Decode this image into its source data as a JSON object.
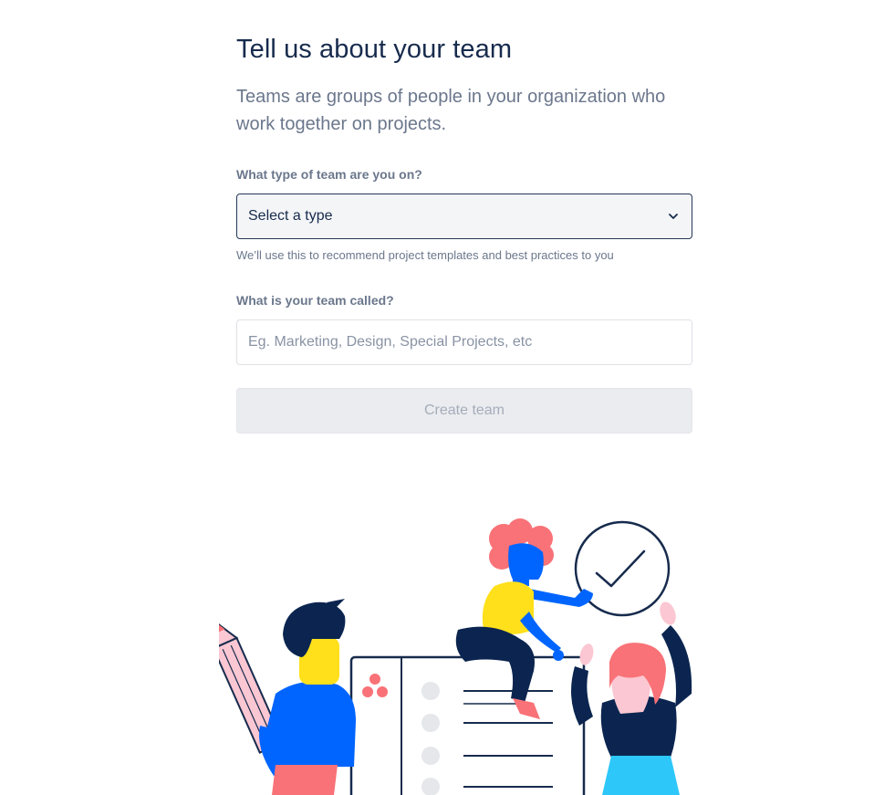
{
  "header": {
    "title": "Tell us about your team",
    "subtitle": "Teams are groups of people in your organization who work together on projects."
  },
  "team_type": {
    "label": "What type of team are you on?",
    "selected_value": "Select a type",
    "helper": "We’ll use this to recommend project templates and best practices to you",
    "icon": "chevron-down-icon"
  },
  "team_name": {
    "label": "What is your team called?",
    "placeholder": "Eg. Marketing, Design, Special Projects, etc",
    "value": ""
  },
  "submit": {
    "label": "Create team",
    "disabled": true
  },
  "colors": {
    "text_primary": "#172b4d",
    "text_secondary": "#6b778c",
    "select_border": "#253858",
    "select_bg": "#f4f5f7",
    "button_bg": "#ebecf0",
    "button_text": "#a5adba",
    "illustration_blue": "#0065ff",
    "illustration_yellow": "#ffe01b",
    "illustration_pink": "#f87277",
    "illustration_navy": "#0b2550",
    "illustration_cyan": "#2ec7fa"
  }
}
